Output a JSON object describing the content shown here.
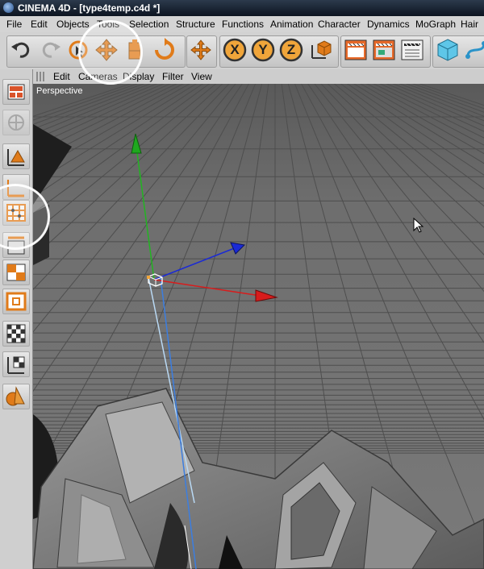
{
  "window": {
    "title": "CINEMA 4D - [type4temp.c4d *]"
  },
  "menubar": {
    "items": [
      "File",
      "Edit",
      "Objects",
      "Tools",
      "Selection",
      "Structure",
      "Functions",
      "Animation",
      "Character",
      "Dynamics",
      "MoGraph",
      "Hair"
    ]
  },
  "toolbar": {
    "axis_x": "X",
    "axis_y": "Y",
    "axis_z": "Z"
  },
  "viewport_menu": {
    "items": [
      "Edit",
      "Cameras",
      "Display",
      "Filter",
      "View"
    ]
  },
  "viewport": {
    "label": "Perspective"
  },
  "colors": {
    "title_bar": "#14202e",
    "grid_background": "#6e6e6e",
    "axis_x": "#d81c1c",
    "axis_y": "#22b422",
    "axis_z": "#1a2ad6",
    "tool_accent": "#e07b1a"
  }
}
